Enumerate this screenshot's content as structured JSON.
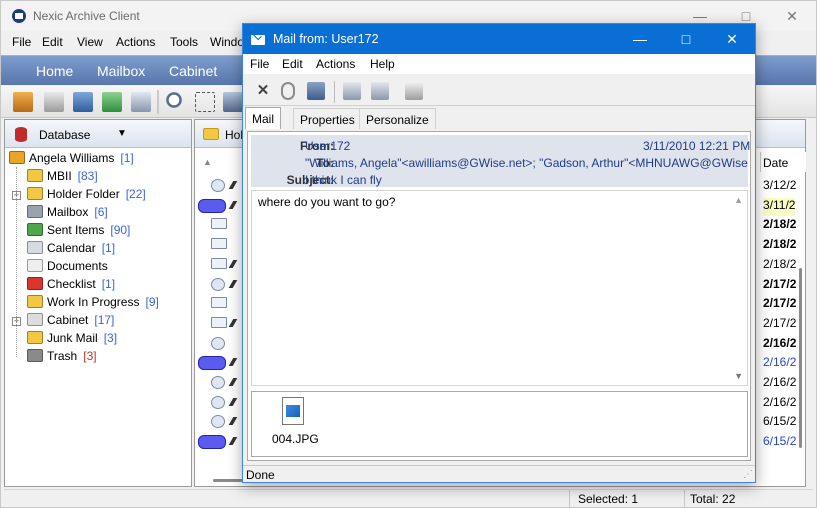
{
  "main": {
    "title": "Nexic Archive Client",
    "menu": [
      "File",
      "Edit",
      "View",
      "Actions",
      "Tools",
      "Windo"
    ],
    "nav": [
      "Home",
      "Mailbox",
      "Cabinet"
    ],
    "database_label": "Database",
    "list_header": "Hol",
    "date_column": "Date",
    "dates": [
      {
        "text": "3/12/2",
        "style": "normal"
      },
      {
        "text": "3/11/2",
        "style": "hl"
      },
      {
        "text": "2/18/2",
        "style": "bold"
      },
      {
        "text": "2/18/2",
        "style": "bold"
      },
      {
        "text": "2/18/2",
        "style": "normal"
      },
      {
        "text": "2/17/2",
        "style": "bold"
      },
      {
        "text": "2/17/2",
        "style": "bold"
      },
      {
        "text": "2/17/2",
        "style": "normal"
      },
      {
        "text": "2/16/2",
        "style": "bold"
      },
      {
        "text": "2/16/2",
        "style": "blue"
      },
      {
        "text": "2/16/2",
        "style": "normal"
      },
      {
        "text": "2/16/2",
        "style": "normal"
      },
      {
        "text": "6/15/2",
        "style": "normal"
      },
      {
        "text": "6/15/2",
        "style": "blue"
      }
    ],
    "tree": [
      {
        "label": "Angela Williams",
        "count": "[1]",
        "icon": "house-icon",
        "color": "#e8a52a",
        "indent": 0
      },
      {
        "label": "MBII",
        "count": "[83]",
        "icon": "folder-icon",
        "color": "#f2c744",
        "indent": 1
      },
      {
        "label": "Holder Folder",
        "count": "[22]",
        "icon": "folder-icon",
        "color": "#f2c744",
        "indent": 1,
        "selected": true
      },
      {
        "label": "Mailbox",
        "count": "[6]",
        "icon": "mailbox-icon",
        "color": "#9aa3ad",
        "indent": 1
      },
      {
        "label": "Sent Items",
        "count": "[90]",
        "icon": "sent-icon",
        "color": "#4ea64e",
        "indent": 1
      },
      {
        "label": "Calendar",
        "count": "[1]",
        "icon": "calendar-icon",
        "color": "#d6dbe3",
        "indent": 1
      },
      {
        "label": "Documents",
        "count": "",
        "icon": "documents-icon",
        "color": "#eeeeee",
        "indent": 1
      },
      {
        "label": "Checklist",
        "count": "[1]",
        "icon": "checklist-icon",
        "color": "#d9372b",
        "indent": 1
      },
      {
        "label": "Work In Progress",
        "count": "[9]",
        "icon": "work-in-progress-icon",
        "color": "#f2c744",
        "indent": 1
      },
      {
        "label": "Cabinet",
        "count": "[17]",
        "icon": "cabinet-icon",
        "color": "#dcdcdc",
        "indent": 1
      },
      {
        "label": "Junk Mail",
        "count": "[3]",
        "icon": "junk-mail-icon",
        "color": "#f2c744",
        "indent": 1
      },
      {
        "label": "Trash",
        "count": "[3]",
        "icon": "trash-icon",
        "color": "#8a8a8a",
        "indent": 1,
        "red": true
      }
    ],
    "status": {
      "selected": "Selected: 1",
      "total": "Total: 22"
    }
  },
  "dialog": {
    "title": "Mail from: User172",
    "menu": [
      "File",
      "Edit",
      "Actions",
      "Help"
    ],
    "tabs": [
      "Mail",
      "Properties",
      "Personalize"
    ],
    "from_label": "From:",
    "from_value": "User172",
    "date_value": "3/11/2010 12:21 PM",
    "to_label": "To:",
    "to_value": "\"Williams, Angela\"<awilliams@GWise.net>; \"Gadson, Arthur\"<MHNUAWG@GWise",
    "subject_label": "Subject:",
    "subject_value": "I think I can fly",
    "body": "where do you want to go?",
    "attachment": "004.JPG",
    "status": "Done"
  }
}
